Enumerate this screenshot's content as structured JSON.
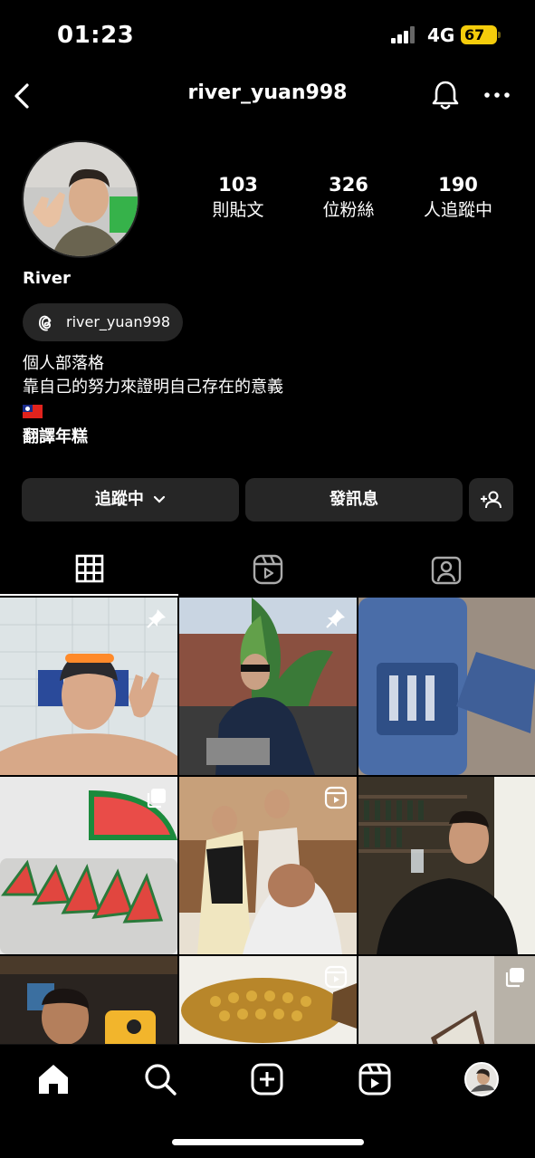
{
  "status": {
    "time": "01:23",
    "network": "4G",
    "battery": "67"
  },
  "header": {
    "username": "river_yuan998"
  },
  "profile": {
    "display_name": "River",
    "threads_handle": "river_yuan998",
    "stats": [
      {
        "number": "103",
        "label": "則貼文"
      },
      {
        "number": "326",
        "label": "位粉絲"
      },
      {
        "number": "190",
        "label": "人追蹤中"
      }
    ],
    "bio": [
      "個人部落格",
      "靠自己的努力來證明自己存在的意義"
    ],
    "bio_bold": "翻譯年糕"
  },
  "buttons": {
    "following": "追蹤中",
    "message": "發訊息"
  },
  "tabs": [
    "grid-tab",
    "reels-tab",
    "tagged-tab"
  ],
  "grid_items": [
    {
      "name": "post-swimmer",
      "badge": "pin-icon"
    },
    {
      "name": "post-garden-sitting",
      "badge": "pin-icon"
    },
    {
      "name": "post-phone-case",
      "badge": ""
    },
    {
      "name": "post-watermelon",
      "badge": "carousel-icon"
    },
    {
      "name": "post-party",
      "badge": "reel-icon"
    },
    {
      "name": "post-bar-drinking",
      "badge": ""
    },
    {
      "name": "post-elevator-selfie",
      "badge": ""
    },
    {
      "name": "post-golden-fish",
      "badge": "reel-icon"
    },
    {
      "name": "post-room",
      "badge": "carousel-icon"
    }
  ],
  "colors": {
    "background": "#000000",
    "button": "#262626",
    "battery": "#f4cc0b"
  }
}
